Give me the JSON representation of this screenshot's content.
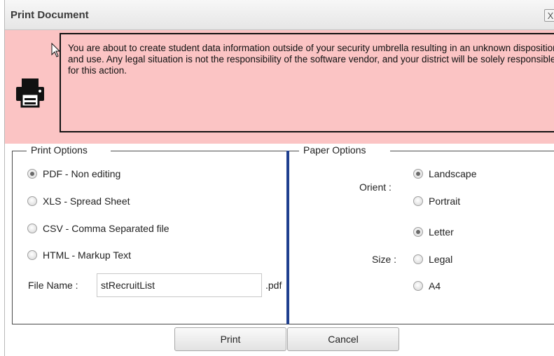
{
  "dialog": {
    "title": "Print Document",
    "close_label": "X",
    "warning": "You are about to create student data information outside of your security umbrella resulting in an unknown disposition and use. Any legal situation is not the responsibility of the software vendor, and your district will be solely responsible for this action.",
    "warning_bg": "#fbc4c4"
  },
  "print_options": {
    "legend": "Print Options",
    "options": [
      {
        "label": "PDF - Non editing",
        "checked": true
      },
      {
        "label": "XLS - Spread Sheet",
        "checked": false
      },
      {
        "label": "CSV - Comma Separated file",
        "checked": false
      },
      {
        "label": "HTML - Markup Text",
        "checked": false
      }
    ],
    "file_name_label": "File Name :",
    "file_name_value": "stRecruitList",
    "file_ext": ".pdf"
  },
  "paper_options": {
    "legend": "Paper Options",
    "orient_label": "Orient :",
    "orient": [
      {
        "label": "Landscape",
        "checked": true
      },
      {
        "label": "Portrait",
        "checked": false
      }
    ],
    "size_label": "Size :",
    "size": [
      {
        "label": "Letter",
        "checked": true
      },
      {
        "label": "Legal",
        "checked": false
      },
      {
        "label": "A4",
        "checked": false
      }
    ]
  },
  "buttons": {
    "print": "Print",
    "cancel": "Cancel"
  },
  "icons": {
    "printer": "printer-icon",
    "cursor": "mouse-cursor-icon",
    "close": "close-icon"
  }
}
